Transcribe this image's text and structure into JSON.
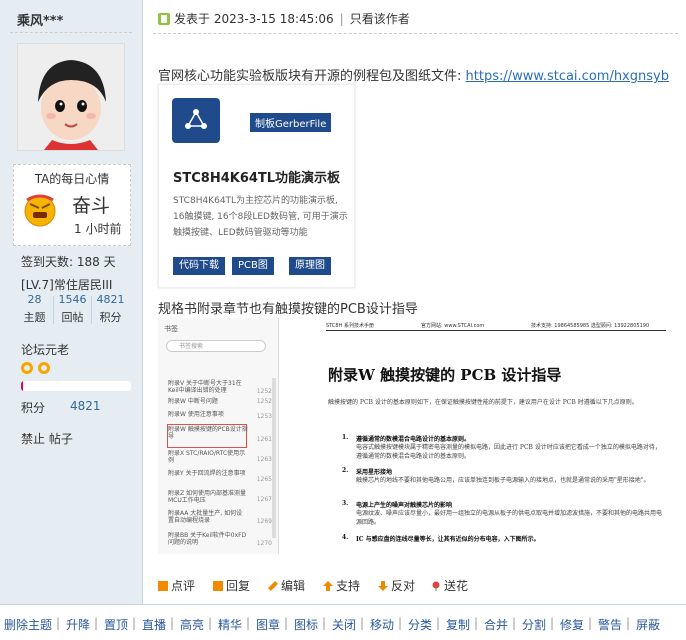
{
  "user": {
    "name": "乘风***",
    "mood_title": "TA的每日心情",
    "mood": "奋斗",
    "mood_time": "1 小时前",
    "signin_days": "签到天数: 188 天",
    "level": "[LV.7]常住居民III",
    "stats": [
      {
        "num": "28",
        "label": "主题"
      },
      {
        "num": "1546",
        "label": "回帖"
      },
      {
        "num": "4821",
        "label": "积分"
      }
    ],
    "title": "论坛元老",
    "progress_fraction": 0.02,
    "score_label": "积分",
    "score": "4821",
    "ban_text": "禁止 帖子"
  },
  "post": {
    "posted_at": "发表于 2023-3-15 18:45:06",
    "separator": "|",
    "only_author": "只看该作者",
    "intro_text": "官网核心功能实验板版块有开源的例程包及图纸文件: ",
    "intro_link": "https://www.stcai.com/hxgnsyb",
    "card": {
      "badge": "制板GerberFile",
      "title": "STC8H4K64TL功能演示板",
      "desc": "STC8H4K64TL为主控芯片的功能演示板, 16触摸键, 16个8段LED数码管, 可用于演示触摸按键、LED数码管驱动等功能",
      "buttons": [
        "代码下载",
        "PCB图",
        "原理图"
      ]
    },
    "caption2": "规格书附录章节也有触摸按键的PCB设计指导",
    "pdf": {
      "sidebar_head": "书签",
      "search_placeholder": "书签搜索",
      "items": [
        {
          "text": "附录V 关于中断号大于31在Keil中编译出错的处理",
          "num": "1252"
        },
        {
          "text": "附录W 中断号问题",
          "num": "1252"
        },
        {
          "text": "附录W 使用注意事项",
          "num": "1253"
        },
        {
          "text": "附录W 触摸按键的PCB设计指导",
          "num": "1261"
        },
        {
          "text": "附录X STC/RAIO/RTC使用示例",
          "num": "1263"
        },
        {
          "text": "附录Y 关于回流焊的注意事项",
          "num": "1265"
        },
        {
          "text": "附录Z 如何使用内部基准测量MCU工作电压",
          "num": "1267"
        },
        {
          "text": "附录AA 大批量生产, 如何设置自动编程烧录",
          "num": "1269"
        },
        {
          "text": "附录BB 关于Keil软件中0xFD问题的说明",
          "num": "1270"
        }
      ],
      "header_left": "STC8H 系列技术手册",
      "header_mid": "官方网站: www.STCAI.com",
      "header_right": "技术支持: 19864585985  选型顾问: 13922805190",
      "heading": "附录W  触摸按键的 PCB 设计指导",
      "para1": "触摸按键的 PCB 设计的基本原则如下，在保证触摸按键性能的前提下，建议用户在设计 PCB 时遵循以下几点原则。",
      "list": [
        {
          "num": "1.",
          "title": "遵循通常的数模混合电路设计的基本原则。",
          "text": "电容式触摸按键模块属于精密电容测量的模拟电路，因此进行 PCB 设计时应该把它看成一个独立的模拟电路对待，遵循通常的数模混合电路设计的基本原则。"
        },
        {
          "num": "2.",
          "title": "采用星形接地",
          "text": "触摸芯片的地线不要和其他电路公用，应该单独连到板子电源输入的接地点，也就是通常说的采用\"星形接地\"。"
        },
        {
          "num": "3.",
          "title": "电源上产生的噪声对触摸芯片的影响",
          "text": "电源纹波、噪声应该尽量小，最好用一组独立的电源从板子的供电点取电并增加滤波措施，不要和其他的电路共用电源回路。"
        },
        {
          "num": "4.",
          "title": "IC 与感应盘的连线尽量等长，让其有近似的分布电容，入下图所示。",
          "text": ""
        }
      ]
    }
  },
  "actions": [
    {
      "label": "点评",
      "icon": "comment-icon",
      "color": "#f08a00"
    },
    {
      "label": "回复",
      "icon": "reply-icon",
      "color": "#f08a00"
    },
    {
      "label": "编辑",
      "icon": "edit-icon",
      "color": "#f08a00"
    },
    {
      "label": "支持",
      "icon": "up-arrow-icon",
      "color": "#f08a00"
    },
    {
      "label": "反对",
      "icon": "down-arrow-icon",
      "color": "#f08a00"
    },
    {
      "label": "送花",
      "icon": "flower-icon",
      "color": "#e04040"
    }
  ],
  "moderation": [
    "删除主题",
    "升降",
    "置顶",
    "直播",
    "高亮",
    "精华",
    "图章",
    "图标",
    "关闭",
    "移动",
    "分类",
    "复制",
    "合并",
    "分割",
    "修复",
    "警告",
    "屏蔽"
  ],
  "colors": {
    "sidebar_bg": "#e5edf2",
    "link": "#2a6ebb",
    "brand_blue": "#1f4b8c",
    "accent_orange": "#f08a00"
  }
}
